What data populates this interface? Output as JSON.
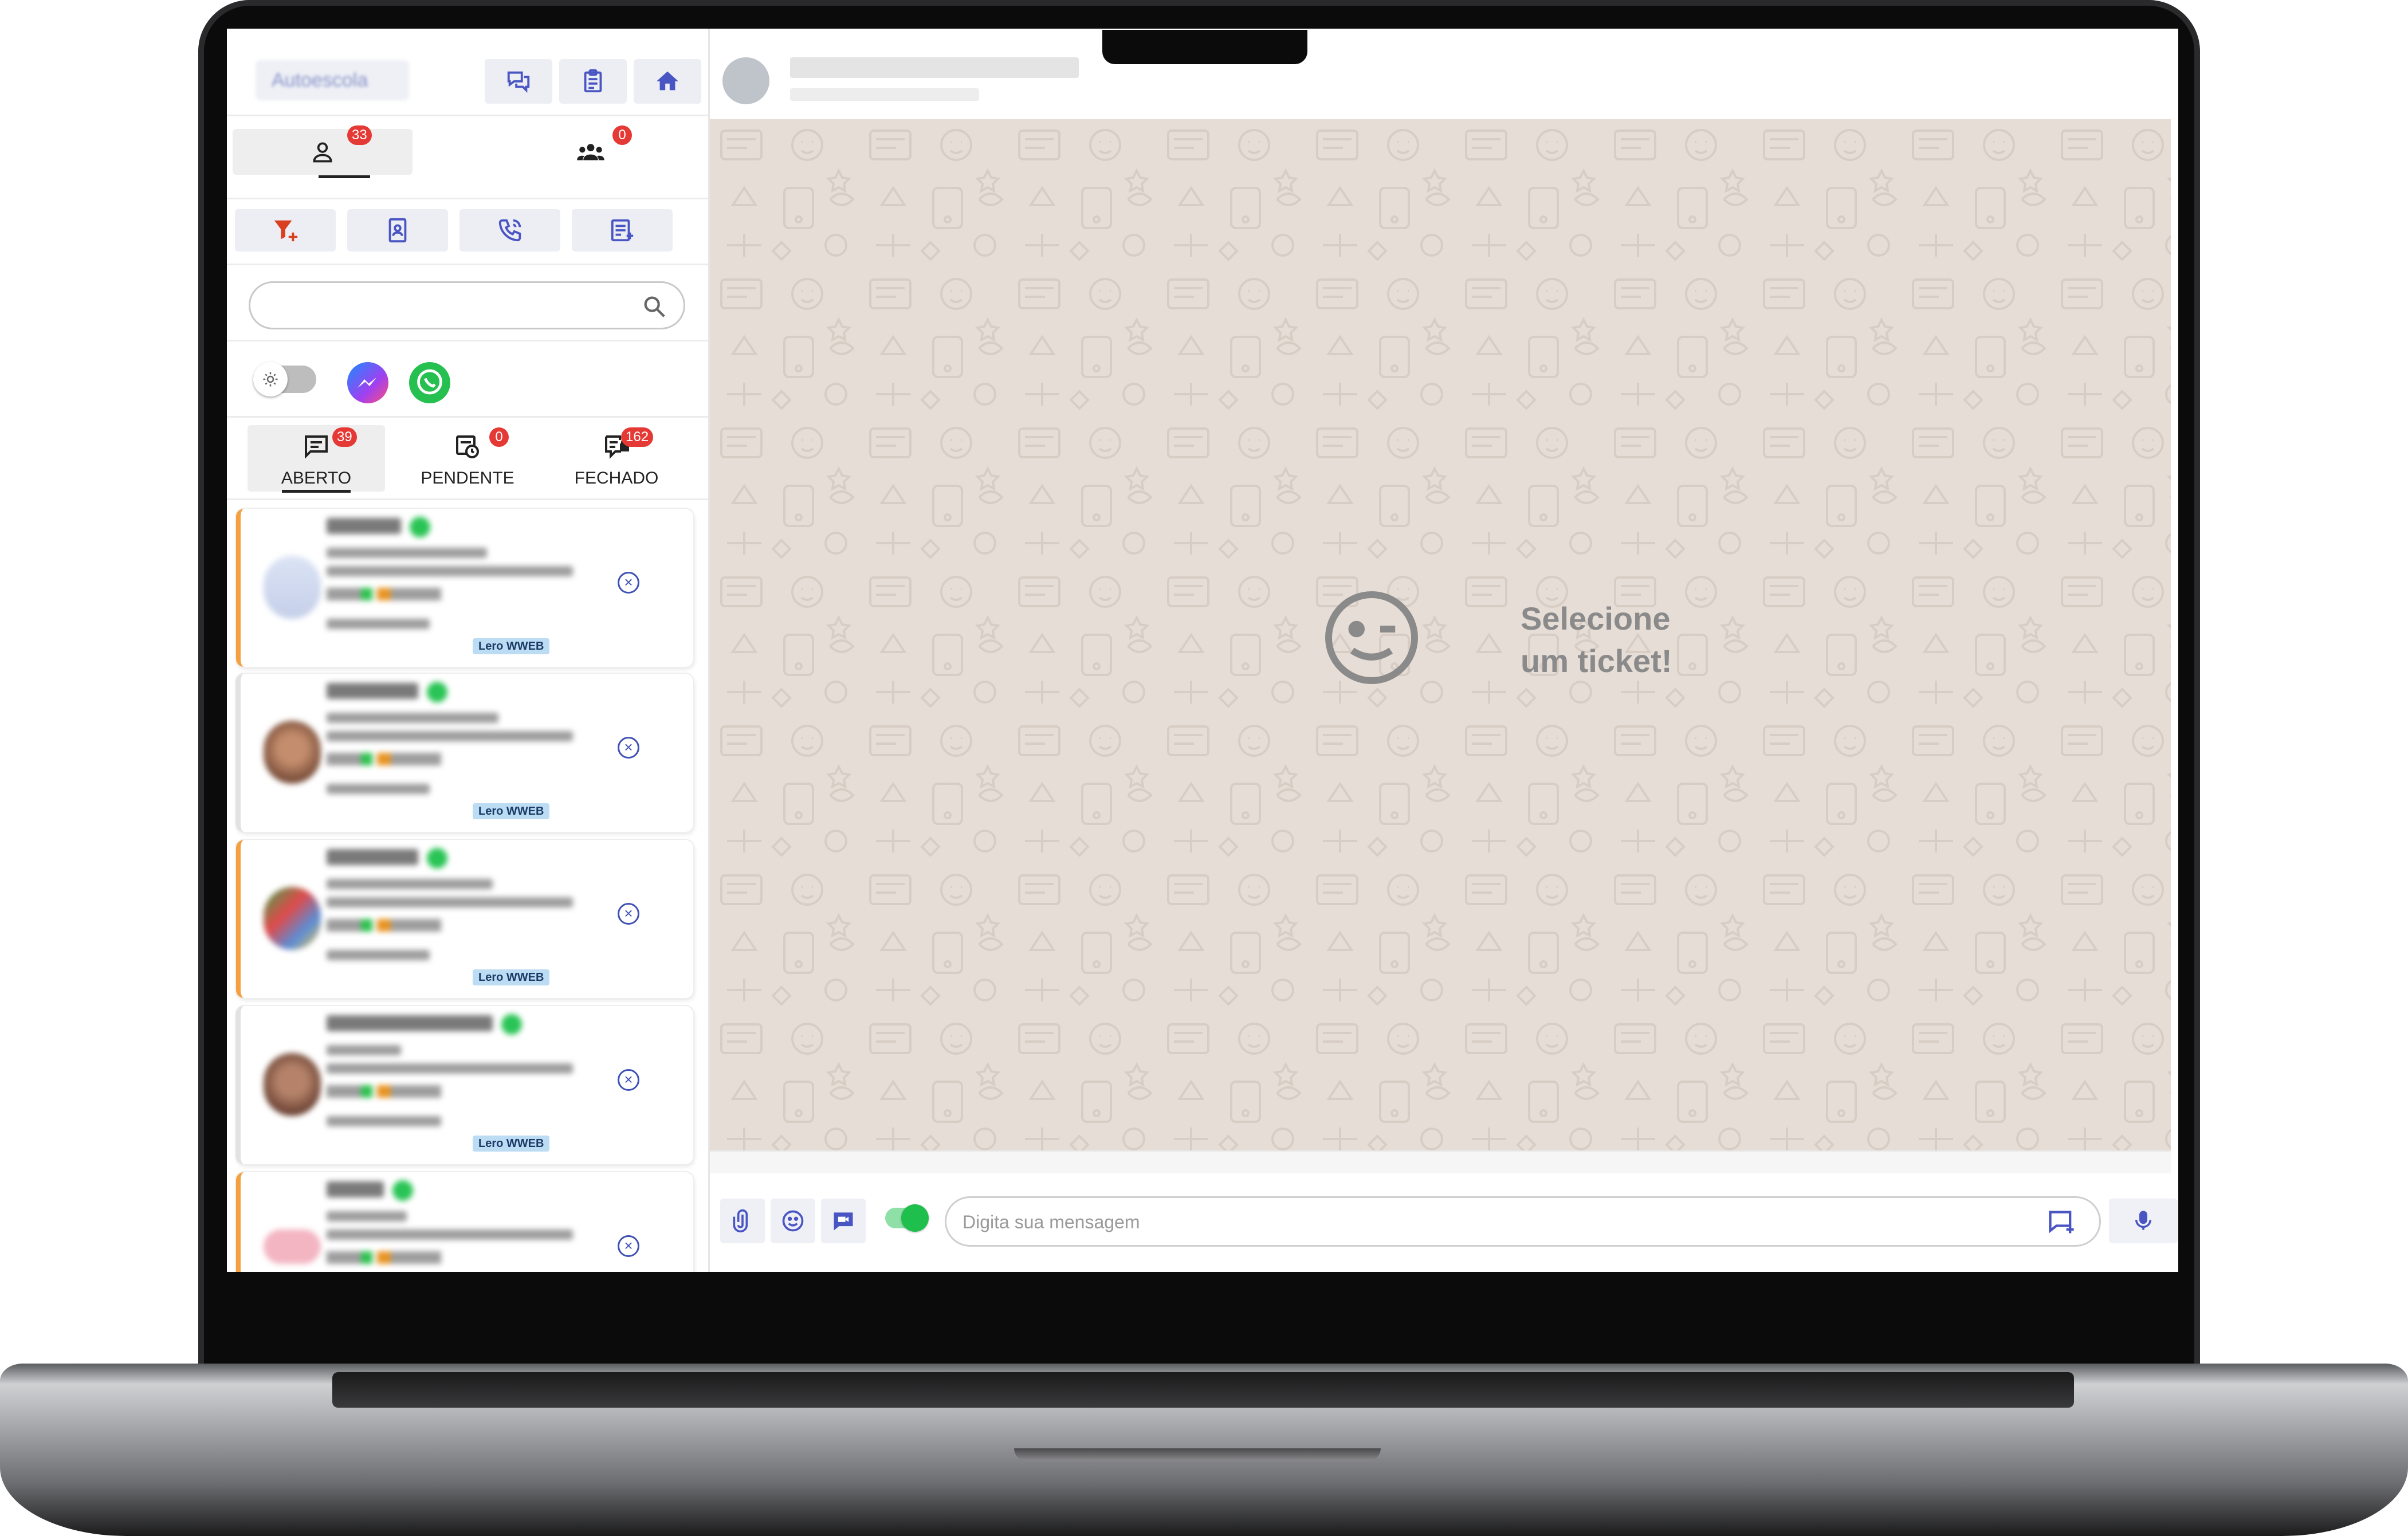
{
  "header": {
    "company_name": "Autoescola",
    "buttons": [
      "chats-icon",
      "clipboard-icon",
      "home-icon"
    ]
  },
  "user_tabs": [
    {
      "icon": "person-icon",
      "count": "33",
      "active": true
    },
    {
      "icon": "group-icon",
      "count": "0",
      "active": false
    }
  ],
  "actions": [
    "filter-add-icon",
    "contact-book-icon",
    "phone-call-icon",
    "new-note-icon"
  ],
  "channels": [
    "theme-toggle",
    "messenger-icon",
    "whatsapp-icon"
  ],
  "status_tabs": [
    {
      "label": "ABERTO",
      "count": "39",
      "active": true
    },
    {
      "label": "PENDENTE",
      "count": "0",
      "active": false
    },
    {
      "label": "FECHADO",
      "count": "162",
      "active": false
    }
  ],
  "tickets": [
    {
      "tag": "Lero WWEB",
      "accent": "#f4a040"
    },
    {
      "tag": "Lero WWEB",
      "accent": "#e2e2e2"
    },
    {
      "tag": "Lero WWEB",
      "accent": "#f4a040"
    },
    {
      "tag": "Lero WWEB",
      "accent": "#e2e2e2"
    },
    {
      "tag": "",
      "accent": "#f4a040"
    }
  ],
  "empty_state": {
    "line1": "Selecione",
    "line2": "um ticket!"
  },
  "composer": {
    "placeholder": "Digita sua mensagem"
  },
  "colors": {
    "accent": "#4a55c4",
    "badge": "#e53935",
    "chat_bg": "#e6ddd6",
    "whatsapp_green": "#1fbf4e"
  }
}
